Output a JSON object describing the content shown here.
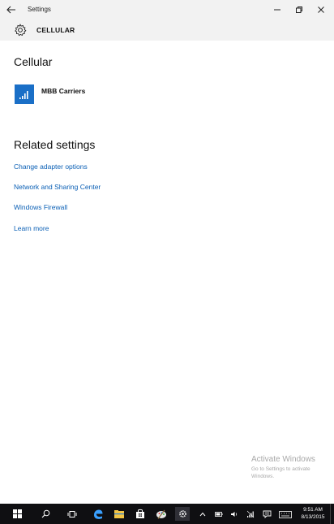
{
  "window": {
    "title": "Settings",
    "back_icon": "arrow-left-icon",
    "minimize_icon": "minimize-icon",
    "maximize_icon": "restore-icon",
    "close_icon": "close-icon"
  },
  "header": {
    "icon": "gear-icon",
    "title": "CELLULAR"
  },
  "cellular": {
    "section_title": "Cellular",
    "carrier_label": "MBB Carriers",
    "carrier_icon": "signal-bars-icon",
    "tile_color": "#1a6fc7"
  },
  "related": {
    "section_title": "Related settings",
    "links": [
      "Change adapter options",
      "Network and Sharing Center",
      "Windows Firewall",
      "Learn more"
    ]
  },
  "watermark": {
    "title": "Activate Windows",
    "line1": "Go to Settings to activate",
    "line2": "Windows."
  },
  "taskbar": {
    "time": "9:51 AM",
    "date": "8/13/2015",
    "apps": [
      "windows-start-icon",
      "search-icon",
      "task-view-icon",
      "edge-icon",
      "file-explorer-icon",
      "store-icon",
      "paint-icon",
      "settings-icon"
    ],
    "tray": [
      "chevron-up-icon",
      "battery-icon",
      "volume-icon",
      "network-icon",
      "action-center-icon",
      "keyboard-icon"
    ],
    "colors": {
      "background": "#0f0f12",
      "accent": "#1a6fc7"
    }
  },
  "colors": {
    "link": "#0a5fb5",
    "titlebar_bg": "#f2f2f2",
    "watermark": "#a8a8a8"
  }
}
